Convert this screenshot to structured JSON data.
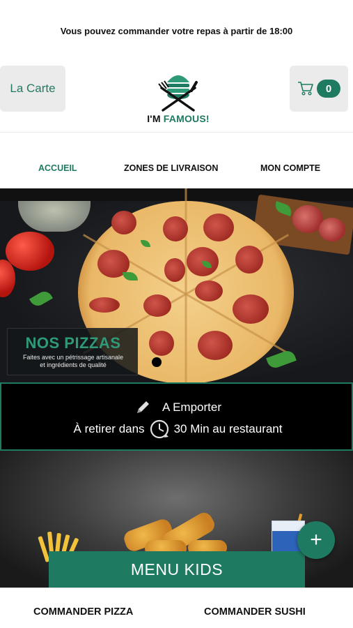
{
  "notice": {
    "text": "Vous pouvez commander votre repas à partir de 18:00"
  },
  "header": {
    "menu_button_label": "La Carte",
    "cart_count": "0",
    "logo": {
      "im": "I'M ",
      "famous": "FAMOUS",
      "bang": "!"
    }
  },
  "nav": {
    "items": [
      {
        "label": "ACCUEIL",
        "active": true
      },
      {
        "label": "ZONES DE LIVRAISON",
        "active": false
      },
      {
        "label": "MON COMPTE",
        "active": false
      }
    ]
  },
  "hero": {
    "title": "NOS PIZZAS",
    "subtitle_line1": "Faites avec un pétrissage artisanale",
    "subtitle_line2": "et ingrédients de qualité"
  },
  "order_info": {
    "mode": "A Emporter",
    "pickup_prefix": "À retirer dans",
    "pickup_time": "30 Min au restaurant"
  },
  "promo": {
    "button_label": "MENU KIDS",
    "fab_label": "+"
  },
  "bottom_bar": {
    "left_label": "COMMANDER PIZZA",
    "right_label": "COMMANDER SUSHI"
  },
  "colors": {
    "accent": "#1f7a62",
    "button_bg": "#ebebeb",
    "text": "#111111"
  },
  "icons": [
    "cart-icon",
    "pencil-icon",
    "clock-icon",
    "plus-icon"
  ]
}
